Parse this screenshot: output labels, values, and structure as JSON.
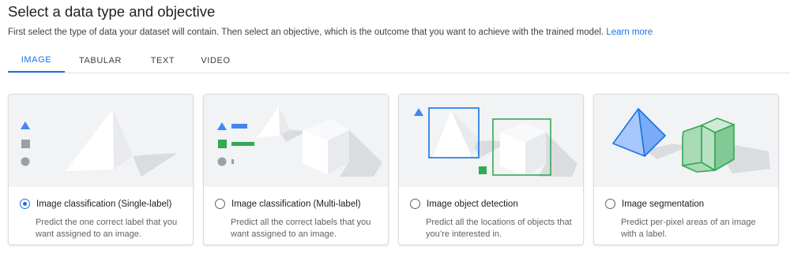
{
  "header": {
    "title": "Select a data type and objective",
    "subtitle": "First select the type of data your dataset will contain. Then select an objective, which is the outcome that you want to achieve with the trained model.",
    "learn_more": "Learn more"
  },
  "tabs": [
    {
      "label": "IMAGE",
      "active": true
    },
    {
      "label": "TABULAR",
      "active": false
    },
    {
      "label": "TEXT",
      "active": false
    },
    {
      "label": "VIDEO",
      "active": false
    }
  ],
  "objectives": [
    {
      "label": "Image classification (Single-label)",
      "desc1": "Predict the one correct label that you",
      "desc2": "want assigned to an image.",
      "selected": true
    },
    {
      "label": "Image classification (Multi-label)",
      "desc1": "Predict all the correct labels that you",
      "desc2": "want assigned to an image.",
      "selected": false
    },
    {
      "label": "Image object detection",
      "desc1": "Predict all the locations of objects that",
      "desc2": "you’re interested in.",
      "selected": false
    },
    {
      "label": "Image segmentation",
      "desc1": "Predict per-pixel areas of an image",
      "desc2": "with a label.",
      "selected": false
    }
  ],
  "icons": {
    "card1": [
      "triangle-icon",
      "square-icon",
      "circle-icon",
      "pyramid-illustration"
    ],
    "card2": [
      "label-list-icon",
      "pyramid-illustration",
      "cube-illustration"
    ],
    "card3": [
      "bounding-box-icon",
      "pyramid-illustration",
      "cube-illustration"
    ],
    "card4": [
      "segmented-pyramid-illustration",
      "segmented-hexagon-illustration"
    ]
  },
  "colors": {
    "accent": "#1a73e8",
    "blue_shape": "#4285f4",
    "green_shape": "#34a853",
    "gray_shape": "#9aa0a6",
    "illustration_bg": "#f1f3f4"
  }
}
